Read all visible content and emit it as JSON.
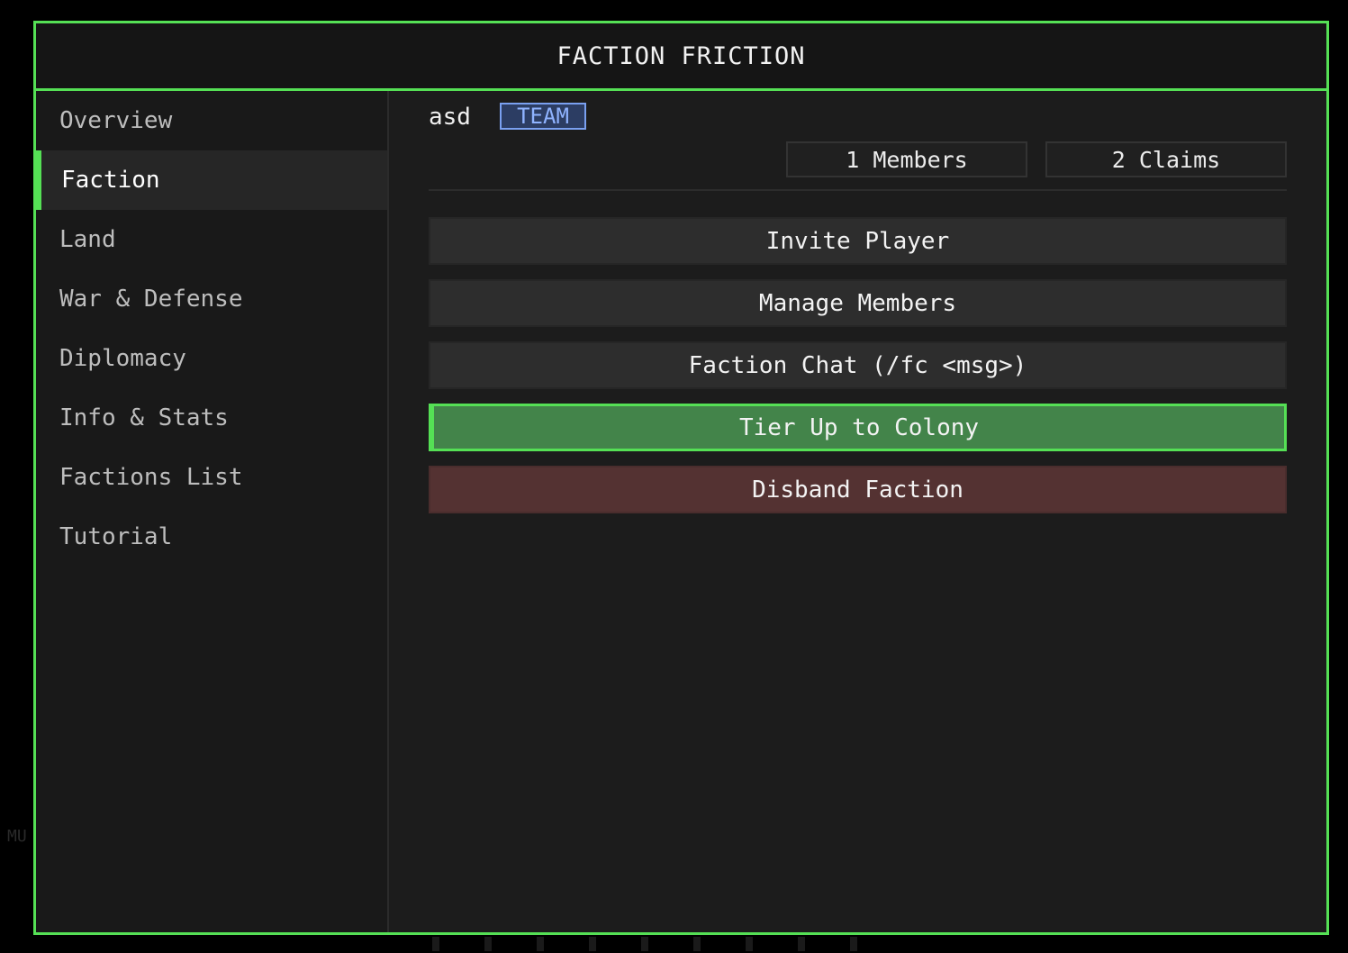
{
  "window": {
    "title": "FACTION FRICTION"
  },
  "background": {
    "fragment": "MU"
  },
  "sidebar": {
    "items": [
      {
        "label": "Overview"
      },
      {
        "label": "Faction",
        "active": true
      },
      {
        "label": "Land"
      },
      {
        "label": "War & Defense"
      },
      {
        "label": "Diplomacy"
      },
      {
        "label": "Info & Stats"
      },
      {
        "label": "Factions List"
      },
      {
        "label": "Tutorial"
      }
    ]
  },
  "faction": {
    "name": "asd",
    "tier_badge": "TEAM",
    "members_label": "1 Members",
    "claims_label": "2 Claims"
  },
  "actions": {
    "invite": "Invite Player",
    "manage": "Manage Members",
    "chat": "Faction Chat (/fc <msg>)",
    "tier_up": "Tier Up to Colony",
    "disband": "Disband Faction"
  },
  "colors": {
    "accent": "#55e055",
    "badge_border": "#7aa0f0",
    "tier_button": "#43844a",
    "disband_button": "#543232"
  }
}
